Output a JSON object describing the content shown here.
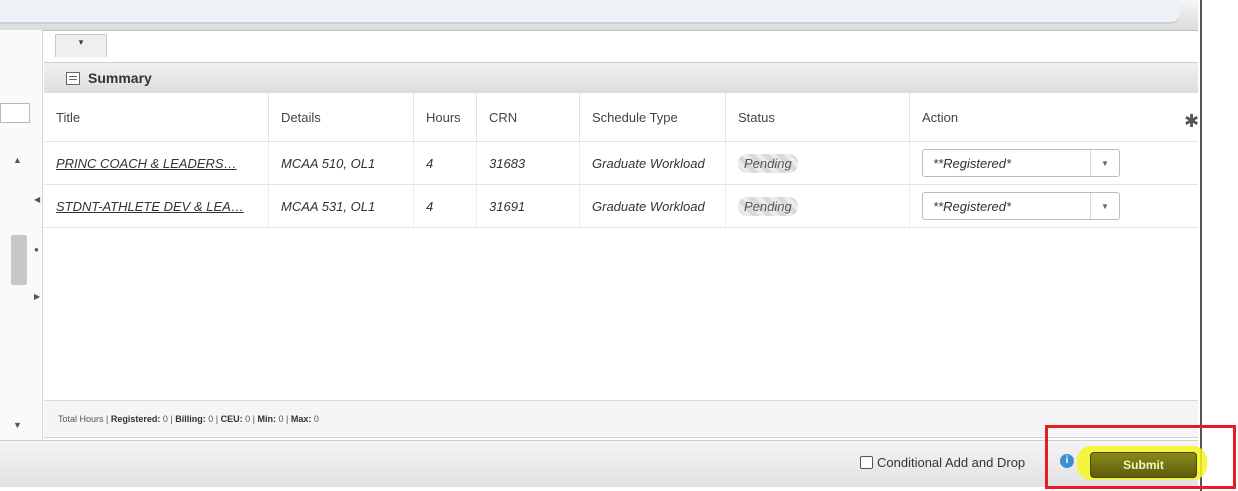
{
  "summary": {
    "title": "Summary",
    "columns": [
      "Title",
      "Details",
      "Hours",
      "CRN",
      "Schedule Type",
      "Status",
      "Action"
    ],
    "rows": [
      {
        "title": "PRINC COACH & LEADERS…",
        "details": "MCAA 510, OL1",
        "hours": "4",
        "crn": "31683",
        "schedule_type": "Graduate Workload",
        "status": "Pending",
        "action": "**Registered*"
      },
      {
        "title": "STDNT-ATHLETE DEV & LEA…",
        "details": "MCAA 531, OL1",
        "hours": "4",
        "crn": "31691",
        "schedule_type": "Graduate Workload",
        "status": "Pending",
        "action": "**Registered*"
      }
    ]
  },
  "totals": {
    "prefix": "Total Hours |",
    "registered_label": "Registered:",
    "registered": "0",
    "billing_label": "Billing:",
    "billing": "0",
    "ceu_label": "CEU:",
    "ceu": "0",
    "min_label": "Min:",
    "min": "0",
    "max_label": "Max:",
    "max": "0"
  },
  "footer": {
    "conditional_label": "Conditional Add and Drop",
    "submit_label": "Submit"
  },
  "icons": {
    "settings": "gear-icon",
    "info": "info-icon",
    "summary": "list-icon"
  },
  "colors": {
    "highlight": "#f6f41e",
    "submit_bg": "#6e6e12",
    "annotation_box": "#e81c24",
    "info": "#3d8fd0"
  }
}
